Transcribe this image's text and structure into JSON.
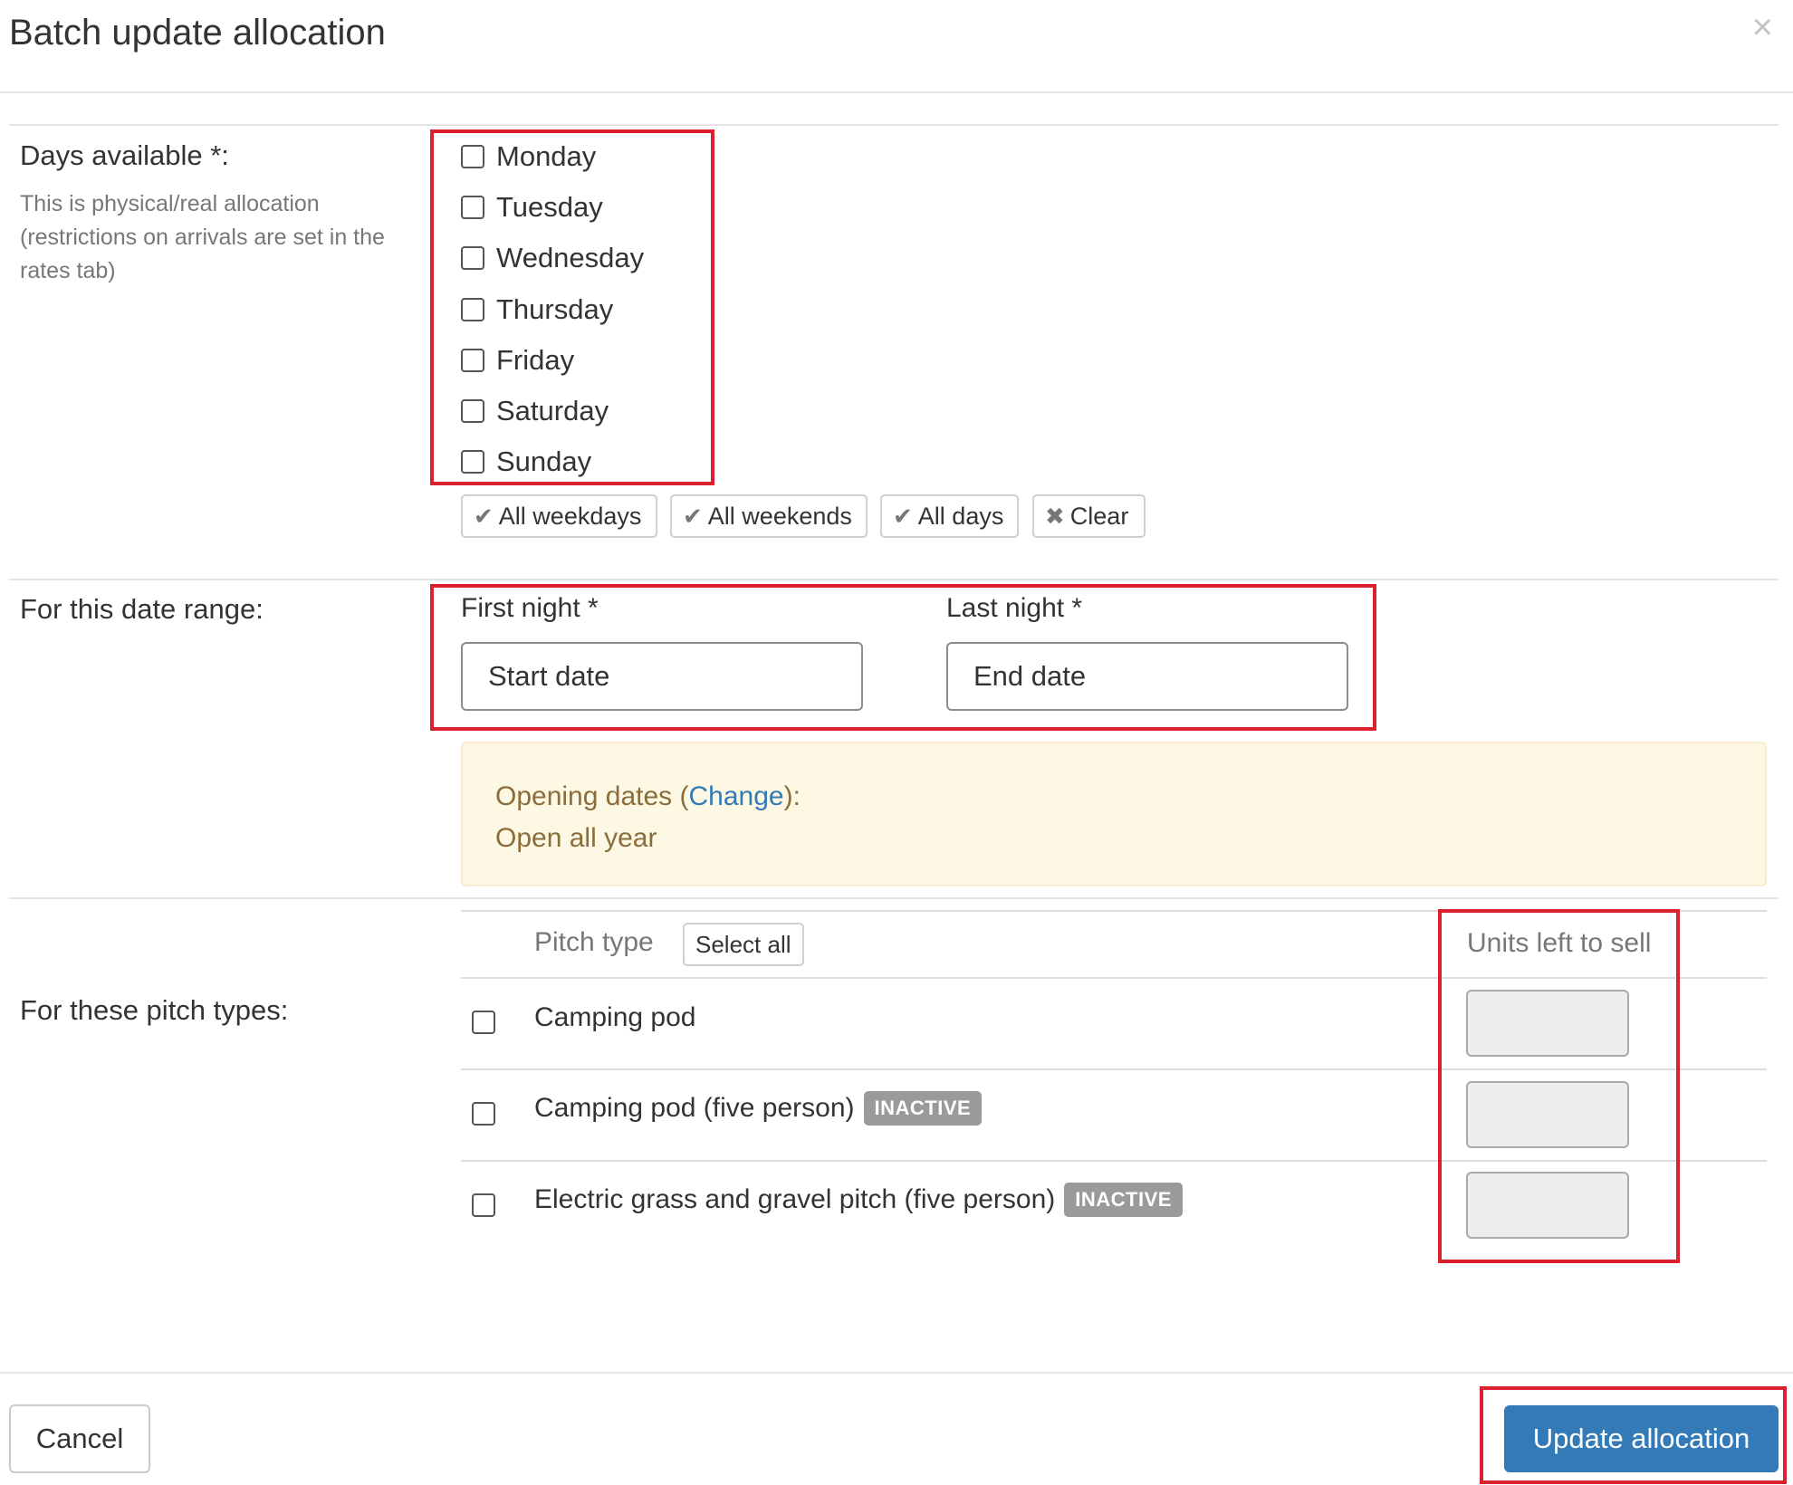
{
  "modal": {
    "title": "Batch update allocation",
    "close_glyph": "×"
  },
  "days": {
    "label": "Days available *:",
    "help": "This is physical/real allocation (restrictions on arrivals are set in the rates tab)",
    "items": [
      {
        "label": "Monday",
        "checked": false
      },
      {
        "label": "Tuesday",
        "checked": false
      },
      {
        "label": "Wednesday",
        "checked": false
      },
      {
        "label": "Thursday",
        "checked": false
      },
      {
        "label": "Friday",
        "checked": false
      },
      {
        "label": "Saturday",
        "checked": false
      },
      {
        "label": "Sunday",
        "checked": false
      }
    ],
    "quick": {
      "all_weekdays": "All weekdays",
      "all_weekends": "All weekends",
      "all_days": "All days",
      "clear": "Clear",
      "check_glyph": "✔",
      "clear_glyph": "✖"
    }
  },
  "date_range": {
    "label": "For this date range:",
    "first_label": "First night *",
    "first_placeholder": "Start date",
    "last_label": "Last night *",
    "last_placeholder": "End date"
  },
  "opening": {
    "prefix": "Opening dates (",
    "link": "Change",
    "suffix": "):",
    "value": "Open all year"
  },
  "pitch": {
    "label": "For these pitch types:",
    "header_type": "Pitch type",
    "select_all": "Select all",
    "header_units": "Units left to sell",
    "rows": [
      {
        "name": "Camping pod",
        "badge": "",
        "checked": false,
        "units": ""
      },
      {
        "name": "Camping pod (five person)",
        "badge": "INACTIVE",
        "checked": false,
        "units": ""
      },
      {
        "name": "Electric grass and gravel pitch (five person)",
        "badge": "INACTIVE",
        "checked": false,
        "units": ""
      }
    ]
  },
  "footer": {
    "cancel": "Cancel",
    "update": "Update allocation"
  },
  "colors": {
    "primary": "#337ab7",
    "highlight": "#d9212f",
    "alert_bg": "#fcf8e3",
    "alert_text": "#8a6d3b",
    "badge_bg": "#9a9a9a"
  }
}
